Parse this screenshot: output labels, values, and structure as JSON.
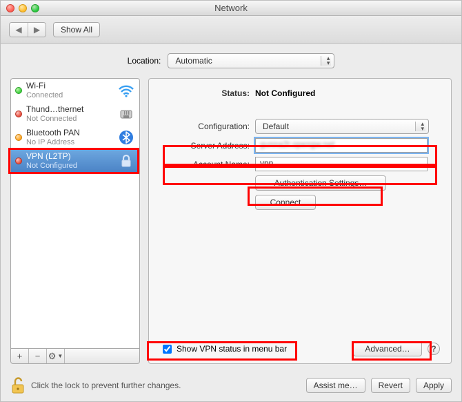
{
  "window": {
    "title": "Network"
  },
  "toolbar": {
    "show_all": "Show All"
  },
  "location": {
    "label": "Location:",
    "value": "Automatic"
  },
  "sidebar": {
    "items": [
      {
        "name": "Wi-Fi",
        "status": "Connected",
        "dot": "green",
        "icon": "wifi"
      },
      {
        "name": "Thund…thernet",
        "status": "Not Connected",
        "dot": "red",
        "icon": "ethernet"
      },
      {
        "name": "Bluetooth PAN",
        "status": "No IP Address",
        "dot": "orange",
        "icon": "bluetooth"
      },
      {
        "name": "VPN (L2TP)",
        "status": "Not Configured",
        "dot": "red",
        "icon": "vpn",
        "selected": true
      }
    ],
    "toolbar": {
      "plus": "+",
      "minus": "−",
      "gear": "⚙︎"
    }
  },
  "pane": {
    "status_label": "Status:",
    "status_value": "Not Configured",
    "config_label": "Configuration:",
    "config_value": "Default",
    "server_label": "Server Address:",
    "server_value": "gunna2t.opengw.net",
    "account_label": "Account Name:",
    "account_value": "vpn",
    "auth_button": "Authentication Settings…",
    "connect_button": "Connect",
    "menubar_checkbox": "Show VPN status in menu bar",
    "advanced_button": "Advanced…"
  },
  "footer": {
    "lock_text": "Click the lock to prevent further changes.",
    "assist": "Assist me…",
    "revert": "Revert",
    "apply": "Apply"
  }
}
